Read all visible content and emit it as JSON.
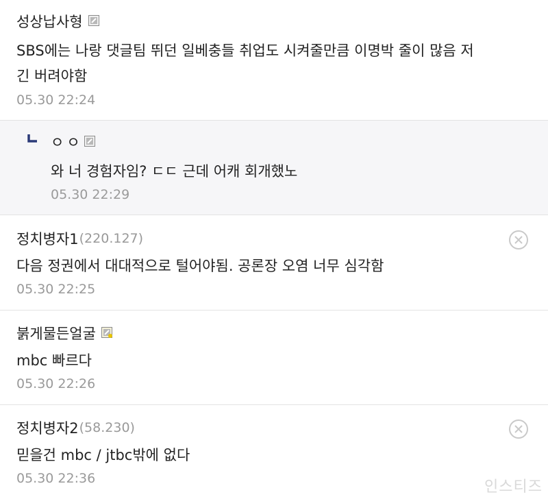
{
  "comments": [
    {
      "name": "성상납사형",
      "ip": "",
      "line1": "SBS에는 나랑 댓글팀 뛰던 일베충들 취업도 시켜줄만큼 이명박 줄이 많음 저",
      "line2": "긴 버려야함",
      "time": "05.30 22:24",
      "level_icon": "gray-level-icon"
    },
    {
      "name": "ㅇㅇ",
      "ip": "",
      "line1": "와 너 경험자임? ㄷㄷ 근데 어캐 회개했노",
      "line2": "",
      "time": "05.30 22:29",
      "level_icon": "gray-level-icon",
      "is_reply": true
    },
    {
      "name": "정치병자1",
      "ip": "(220.127)",
      "line1": "다음 정권에서 대대적으로 털어야됨. 공론장 오염 너무 심각함",
      "line2": "",
      "time": "05.30 22:25"
    },
    {
      "name": "붉게물든얼굴",
      "ip": "",
      "line1": "mbc 빠르다",
      "line2": "",
      "time": "05.30 22:26",
      "level_icon": "yellow-level-icon"
    },
    {
      "name": "정치병자2",
      "ip": "(58.230)",
      "line1": "믿을건 mbc / jtbc밖에 없다",
      "line2": "",
      "time": "05.30 22:36"
    }
  ],
  "watermark": "인스티즈",
  "colors": {
    "reply_bg": "#f6f6f8",
    "reply_arrow": "#2b3a78",
    "divider": "#e3e3e3",
    "time": "#9a9a9a"
  }
}
